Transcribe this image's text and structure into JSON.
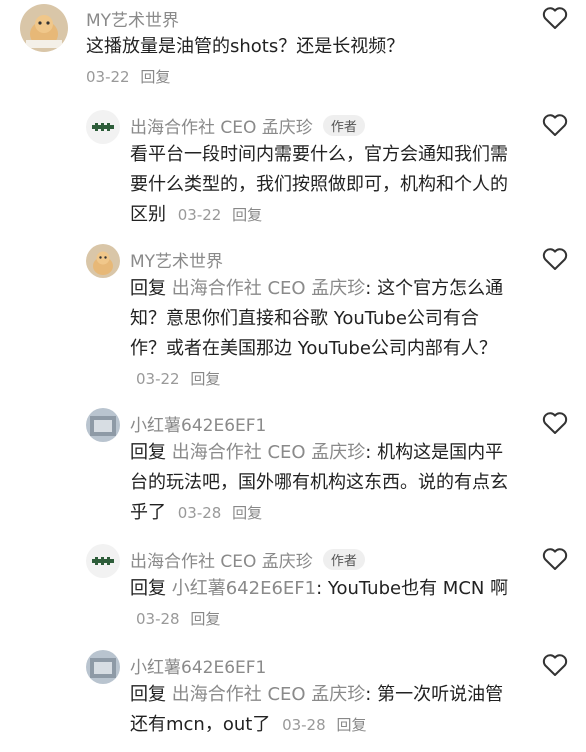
{
  "icons": {
    "like": "heart-outline-icon"
  },
  "comments": [
    {
      "author": "MY艺术世界",
      "mention": "",
      "text": "这播放量是油管的shots？还是长视频？",
      "date": "03-22",
      "reply": "回复"
    },
    {
      "author": "出海合作社 CEO 孟庆珍",
      "badge": "作者",
      "mention": "",
      "text": "看平台一段时间内需要什么，官方会通知我们需要什么类型的，我们按照做即可，机构和个人的区别",
      "date": "03-22",
      "reply": "回复"
    },
    {
      "author": "MY艺术世界",
      "prefix": "回复",
      "mention": "出海合作社 CEO 孟庆珍",
      "text": ": 这个官方怎么通知？意思你们直接和谷歌 YouTube公司有合作？或者在美国那边 YouTube公司内部有人？",
      "date": "03-22",
      "reply": "回复"
    },
    {
      "author": "小红薯642E6EF1",
      "prefix": "回复",
      "mention": "出海合作社 CEO 孟庆珍",
      "text": ": 机构这是国内平台的玩法吧，国外哪有机构这东西。说的有点玄乎了",
      "date": "03-28",
      "reply": "回复"
    },
    {
      "author": "出海合作社 CEO 孟庆珍",
      "badge": "作者",
      "prefix": "回复",
      "mention": "小红薯642E6EF1",
      "text": ": YouTube也有 MCN 啊",
      "date": "03-28",
      "reply": "回复"
    },
    {
      "author": "小红薯642E6EF1",
      "prefix": "回复",
      "mention": "出海合作社 CEO 孟庆珍",
      "text": ": 第一次听说油管还有mcn，out了",
      "date": "03-28",
      "reply": "回复"
    }
  ]
}
